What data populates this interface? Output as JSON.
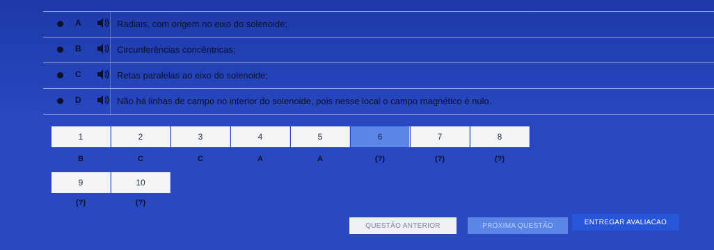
{
  "options": [
    {
      "letter": "A",
      "text": "Radiais, com origem no eixo do solenoide;"
    },
    {
      "letter": "B",
      "text": "Circunferências concêntricas;"
    },
    {
      "letter": "C",
      "text": "Retas paralelas ao eixo do solenoide;"
    },
    {
      "letter": "D",
      "text": "Não há linhas de campo no interior do solenoide, pois nesse local o campo magnético é nulo."
    }
  ],
  "question_grid": [
    {
      "number": "1",
      "answer": "B"
    },
    {
      "number": "2",
      "answer": "C"
    },
    {
      "number": "3",
      "answer": "C"
    },
    {
      "number": "4",
      "answer": "A"
    },
    {
      "number": "5",
      "answer": "A"
    },
    {
      "number": "6",
      "answer": "(?)"
    },
    {
      "number": "7",
      "answer": "(?)"
    },
    {
      "number": "8",
      "answer": "(?)"
    },
    {
      "number": "9",
      "answer": "(?)"
    },
    {
      "number": "10",
      "answer": "(?)"
    }
  ],
  "current_question": "6",
  "buttons": {
    "previous": "QUESTÃO ANTERIOR",
    "next": "PRÓXIMA QUESTÃO",
    "submit": "ENTREGAR AVALIACAO"
  },
  "colors": {
    "background": "#2847c0",
    "current_box": "#5a86e8",
    "submit": "#2956d9"
  },
  "icons": {
    "option_audio": "speaker-icon"
  }
}
